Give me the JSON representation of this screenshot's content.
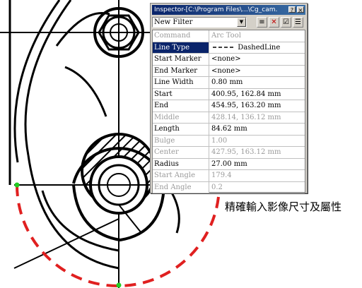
{
  "window": {
    "title": "Inspector-[C:\\Program Files\\...\\Cg_cam.lib]"
  },
  "filter": {
    "selected": "New Filter"
  },
  "properties": [
    {
      "name": "Command",
      "value": "Arc Tool",
      "disabled": true
    },
    {
      "name": "Line Type",
      "value": "DashedLine",
      "selected": true
    },
    {
      "name": "Start Marker",
      "value": "<none>"
    },
    {
      "name": "End Marker",
      "value": "<none>"
    },
    {
      "name": "Line Width",
      "value": "0.80 mm"
    },
    {
      "name": "Start",
      "value": "400.95, 162.84 mm"
    },
    {
      "name": "End",
      "value": "454.95, 163.20 mm"
    },
    {
      "name": "Middle",
      "value": "428.14, 136.12 mm",
      "disabled": true
    },
    {
      "name": "Length",
      "value": "84.62 mm"
    },
    {
      "name": "Bulge",
      "value": "1.00",
      "disabled": true
    },
    {
      "name": "Center",
      "value": "427.95, 163.12 mm",
      "disabled": true
    },
    {
      "name": "Radius",
      "value": "27.00 mm"
    },
    {
      "name": "Start Angle",
      "value": "179.4",
      "disabled": true
    },
    {
      "name": "End Angle",
      "value": "0.2",
      "disabled": true
    }
  ],
  "caption": "精確輸入影像尺寸及屬性",
  "colors": {
    "annotation": "#e02020",
    "titlebar": "#0a246a",
    "point": "#22cc22"
  },
  "icons": {
    "window_buttons": [
      "help-icon",
      "close-icon"
    ],
    "toolbar": [
      "filter-list-icon",
      "delete-icon",
      "check-icon",
      "properties-icon"
    ]
  }
}
